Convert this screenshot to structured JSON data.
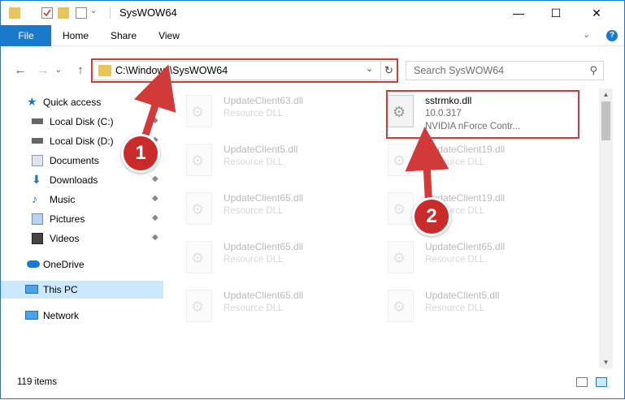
{
  "window": {
    "title": "SysWOW64",
    "minimize": "—",
    "maximize": "☐",
    "close": "✕"
  },
  "ribbon": {
    "tabs": [
      "File",
      "Home",
      "Share",
      "View"
    ],
    "expand": "⌄",
    "help": "?"
  },
  "nav": {
    "back": "←",
    "forward": "→",
    "dropdown": "⌄",
    "up": "↑",
    "address": "C:\\Windows\\SysWOW64",
    "address_dropdown": "⌄",
    "refresh": "↻",
    "search_placeholder": "Search SysWOW64",
    "search_glyph": "⚲"
  },
  "sidebar": {
    "items": [
      {
        "label": "Quick access",
        "icon": "star-icon"
      },
      {
        "label": "Local Disk (C:)",
        "icon": "drive-icon",
        "pinned": true
      },
      {
        "label": "Local Disk (D:)",
        "icon": "drive-icon",
        "pinned": true
      },
      {
        "label": "Documents",
        "icon": "documents-icon",
        "pinned": true
      },
      {
        "label": "Downloads",
        "icon": "downloads-icon",
        "pinned": true
      },
      {
        "label": "Music",
        "icon": "music-icon",
        "pinned": true
      },
      {
        "label": "Pictures",
        "icon": "pictures-icon",
        "pinned": true
      },
      {
        "label": "Videos",
        "icon": "videos-icon",
        "pinned": true
      },
      {
        "label": "OneDrive",
        "icon": "cloud-icon"
      },
      {
        "label": "This PC",
        "icon": "computer-icon",
        "selected": true
      },
      {
        "label": "Network",
        "icon": "network-icon"
      }
    ],
    "pin_glyph": "📌"
  },
  "files": {
    "highlighted": {
      "name": "sstrmko.dll",
      "version": "10.0.317",
      "description": "NVIDIA nForce Contr..."
    },
    "left_column": [
      {
        "name": "UpdateClient63.dll",
        "type": "Resource DLL"
      },
      {
        "name": "UpdateClient5.dll",
        "type": "Resource DLL"
      },
      {
        "name": "UpdateClient65.dll",
        "type": "Resource DLL"
      },
      {
        "name": "UpdateClient65.dll",
        "type": "Resource DLL"
      },
      {
        "name": "UpdateClient65.dll",
        "type": "Resource DLL"
      }
    ],
    "right_column": [
      {
        "name": "UpdateClient19.dll",
        "type": "Resource DLL"
      },
      {
        "name": "UpdateClient19.dll",
        "type": "Resource DLL"
      },
      {
        "name": "UpdateClient65.dll",
        "type": "Resource DLL"
      },
      {
        "name": "UpdateClient5.dll",
        "type": "Resource DLL"
      }
    ],
    "gear_glyph": "⚙"
  },
  "status": {
    "item_count": "119 items"
  },
  "annotations": {
    "step1": "1",
    "step2": "2",
    "arrow_color": "#d23a3a",
    "badge_color": "#c92a2a"
  },
  "colors": {
    "accent": "#1979ca",
    "selection": "#cce8ff",
    "highlight": "#d23a3a"
  }
}
